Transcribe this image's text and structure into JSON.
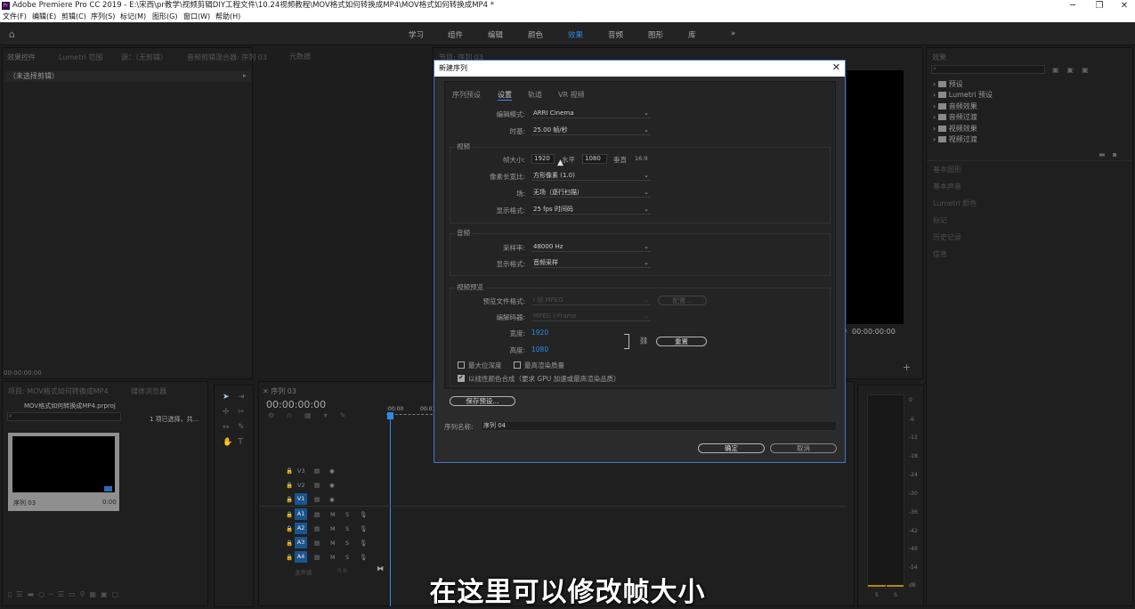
{
  "window": {
    "title": "Adobe Premiere Pro CC 2019 - E:\\宋西\\pr教学\\视频剪辑DIY工程文件\\10.24视频教程\\MOV格式如何转换成MP4\\MOV格式如何转换成MP4 *",
    "logo": "Pr",
    "minimize": "─",
    "restore": "❐",
    "close": "✕"
  },
  "menu": [
    "文件(F)",
    "编辑(E)",
    "剪辑(C)",
    "序列(S)",
    "标记(M)",
    "图形(G)",
    "窗口(W)",
    "帮助(H)"
  ],
  "workspaces": {
    "items": [
      "学习",
      "组件",
      "编辑",
      "颜色",
      "效果",
      "音频",
      "图形",
      "库"
    ],
    "active": "效果",
    "more": "»"
  },
  "left_panel": {
    "tabs": [
      "效果控件",
      "Lumetri 范围",
      "源：（无剪辑）",
      "音频剪辑混合器: 序列 03",
      "元数据"
    ],
    "no_clip": "（未选择剪辑）",
    "timecode": "00:00:00:00"
  },
  "program_monitor": {
    "tab": "节目: 序列 03",
    "timecode": "00:00:00:00"
  },
  "project_panel": {
    "tabs": [
      "项目: MOV格式如何转换成MP4",
      "媒体浏览器"
    ],
    "file": "MOV格式如何转换成MP4.prproj",
    "selection": "1 项已选择，共...",
    "item_name": "序列 03",
    "item_duration": "0:00"
  },
  "timeline": {
    "tab": "序列 03",
    "timecode": "00:00:00:00",
    "ruler": [
      ":00:00",
      "00:01"
    ],
    "video_tracks": [
      "V3",
      "V2",
      "V1"
    ],
    "audio_tracks": [
      "A1",
      "A2",
      "A3",
      "A4"
    ],
    "master": "主声道",
    "master_value": "0.0",
    "mute": "M",
    "solo": "S"
  },
  "effects_panel": {
    "tab": "效果",
    "items": [
      "预设",
      "Lumetri 预设",
      "音频效果",
      "音频过渡",
      "视频效果",
      "视频过渡"
    ],
    "other_panels": [
      "基本图形",
      "基本声音",
      "Lumetri 颜色",
      "标记",
      "历史记录",
      "信息"
    ]
  },
  "audio_meter": {
    "ticks": [
      "0",
      "-6",
      "-12",
      "-18",
      "-24",
      "-30",
      "-36",
      "-42",
      "-48",
      "-54",
      "dB"
    ],
    "channels": [
      "S",
      "S"
    ]
  },
  "dialog": {
    "title": "新建序列",
    "close": "✕",
    "tabs": [
      "序列预设",
      "设置",
      "轨道",
      "VR 视频"
    ],
    "active_tab": "设置",
    "editing_mode_label": "编辑模式:",
    "editing_mode": "ARRI Cinema",
    "timebase_label": "时基:",
    "timebase": "25.00  帧/秒",
    "video_section": "视频",
    "frame_size_label": "帧大小:",
    "frame_width": "1920",
    "horizontal_label": "水平",
    "frame_height": "1080",
    "vertical_label": "垂直",
    "aspect": "16:9",
    "pixel_aspect_label": "像素长宽比:",
    "pixel_aspect": "方形像素 (1.0)",
    "fields_label": "场:",
    "fields": "无场（逐行扫描）",
    "display_format_label": "显示格式:",
    "display_format": "25 fps 时间码",
    "audio_section": "音频",
    "sample_rate_label": "采样率:",
    "sample_rate": "48000 Hz",
    "audio_display_label": "显示格式:",
    "audio_display": "音频采样",
    "preview_section": "视频预览",
    "preview_format_label": "预览文件格式:",
    "preview_format": "I 帧 MPEG",
    "configure": "配置...",
    "codec_label": "编解码器:",
    "codec": "MPEG I-Frame",
    "width_label": "宽度:",
    "width": "1920",
    "height_label": "高度:",
    "height": "1080",
    "reset": "重置",
    "max_bit_depth": "最大位深度",
    "max_render_quality": "最高渲染质量",
    "linear_color": "以线性颜色合成（要求 GPU 加速或最高渲染品质）",
    "save_preset": "保存预设...",
    "sequence_name_label": "序列名称:",
    "sequence_name": "序列 04",
    "ok": "确定",
    "cancel": "取消"
  },
  "subtitle": "在这里可以修改帧大小"
}
